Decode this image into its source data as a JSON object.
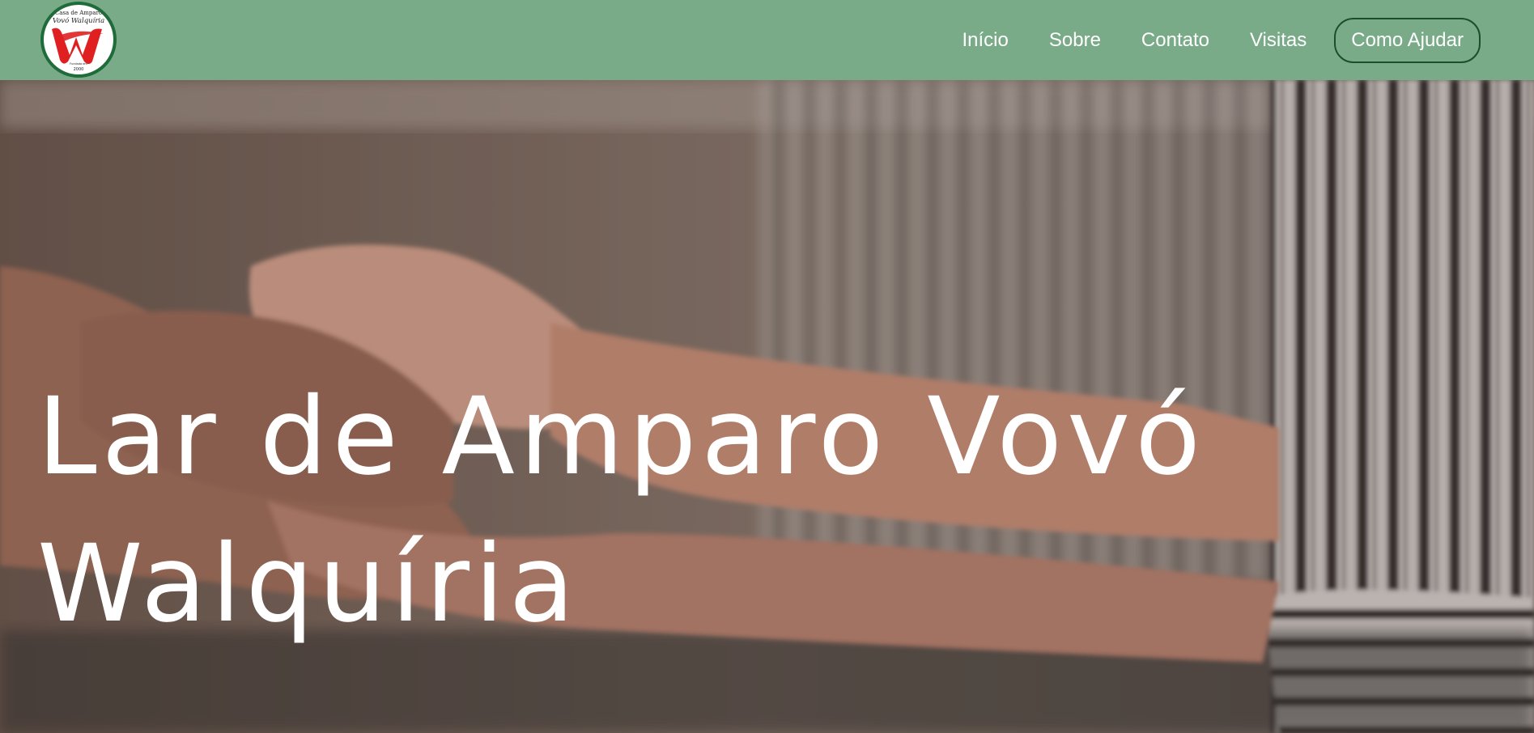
{
  "header": {
    "logo": {
      "top_text": "Casa de Amparo",
      "name_text": "Vovó Walquíria",
      "bottom_text": "Fundada em",
      "year_text": "2000",
      "colors": {
        "ring": "#1f6b3a",
        "mark": "#e02020"
      }
    },
    "nav": {
      "items": [
        {
          "label": "Início"
        },
        {
          "label": "Sobre"
        },
        {
          "label": "Contato"
        },
        {
          "label": "Visitas"
        }
      ],
      "cta_label": "Como Ajudar"
    }
  },
  "hero": {
    "title": "Lar de Amparo Vovó Walquíria"
  },
  "colors": {
    "header_bg": "#7aab88",
    "button_border": "#1e4d2b",
    "text": "#ffffff"
  }
}
